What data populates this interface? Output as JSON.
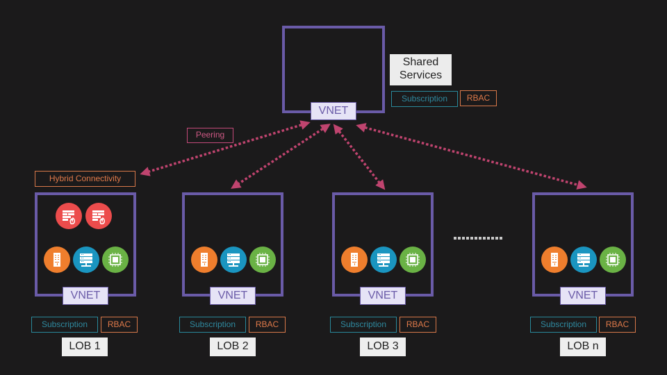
{
  "shared": {
    "title": "Shared Services",
    "vnet_label": "VNET",
    "subscription_label": "Subscription",
    "rbac_label": "RBAC"
  },
  "labels": {
    "peering": "Peering",
    "hybrid_connectivity": "Hybrid Connectivity"
  },
  "colors": {
    "background": "#1b1a1b",
    "vnet_border": "#6a5ba8",
    "peering_arrow": "#c0446f",
    "subscription": "#2f8aa0",
    "rbac": "#e07a4a"
  },
  "lobs": [
    {
      "name": "LOB 1",
      "vnet_label": "VNET",
      "subscription_label": "Subscription",
      "rbac_label": "RBAC",
      "icons": [
        "firewall-icon",
        "firewall-icon",
        "app-service-icon",
        "server-network-icon",
        "cpu-vm-icon"
      ]
    },
    {
      "name": "LOB 2",
      "vnet_label": "VNET",
      "subscription_label": "Subscription",
      "rbac_label": "RBAC",
      "icons": [
        "app-service-icon",
        "server-network-icon",
        "cpu-vm-icon"
      ]
    },
    {
      "name": "LOB 3",
      "vnet_label": "VNET",
      "subscription_label": "Subscription",
      "rbac_label": "RBAC",
      "icons": [
        "app-service-icon",
        "server-network-icon",
        "cpu-vm-icon"
      ]
    },
    {
      "name": "LOB n",
      "vnet_label": "VNET",
      "subscription_label": "Subscription",
      "rbac_label": "RBAC",
      "icons": [
        "app-service-icon",
        "server-network-icon",
        "cpu-vm-icon"
      ]
    }
  ],
  "ellipsis": "more-lobs-indicator"
}
